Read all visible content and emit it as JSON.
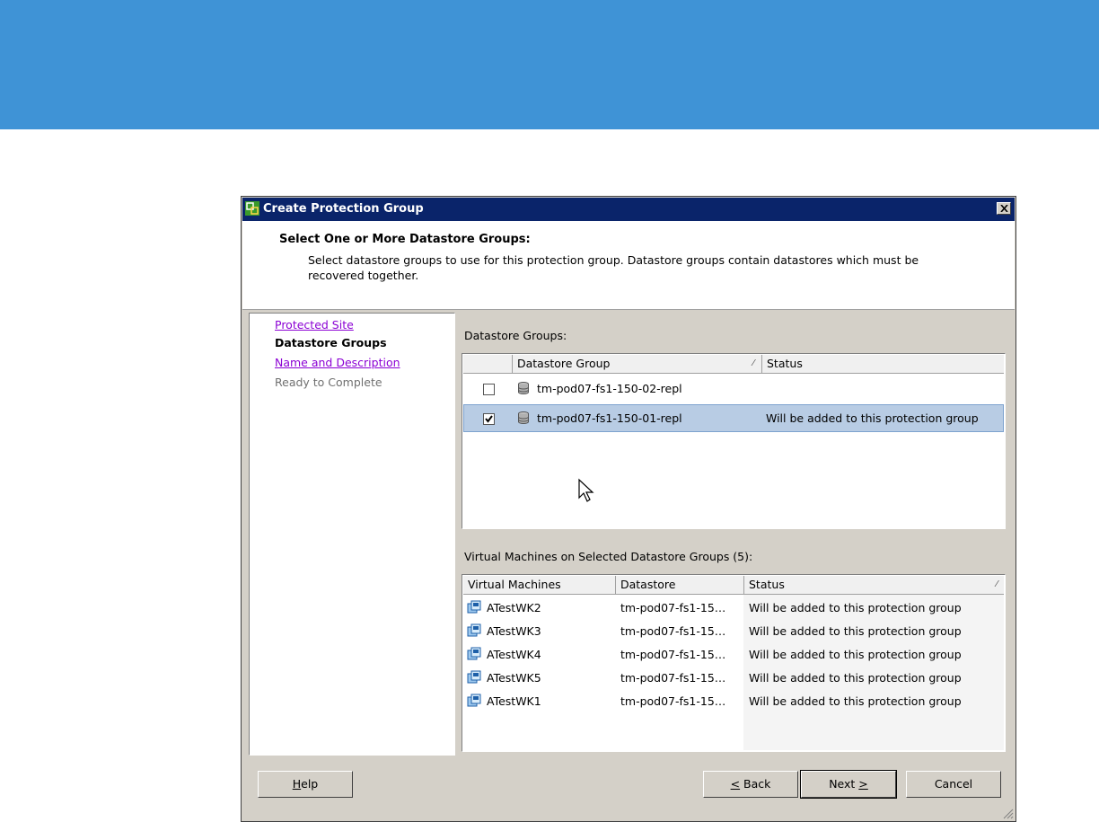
{
  "dialog": {
    "title": "Create Protection Group",
    "header_title": "Select One or More Datastore Groups:",
    "header_description": "Select datastore groups to use for this protection group. Datastore groups contain datastores which must be recovered together."
  },
  "steps": [
    {
      "label": "Protected Site",
      "state": "link"
    },
    {
      "label": "Datastore Groups",
      "state": "current"
    },
    {
      "label": "Name and Description",
      "state": "link"
    },
    {
      "label": "Ready to Complete",
      "state": "disabled"
    }
  ],
  "datastore_groups": {
    "label": "Datastore Groups:",
    "columns": [
      "Datastore Group",
      "Status"
    ],
    "rows": [
      {
        "checked": false,
        "name": "tm-pod07-fs1-150-02-repl",
        "status": ""
      },
      {
        "checked": true,
        "name": "tm-pod07-fs1-150-01-repl",
        "status": "Will be added to this protection group"
      }
    ]
  },
  "vms": {
    "label": "Virtual Machines on Selected Datastore Groups (5):",
    "columns": [
      "Virtual Machines",
      "Datastore",
      "Status"
    ],
    "rows": [
      {
        "name": "ATestWK2",
        "datastore": "tm-pod07-fs1-15…",
        "status": "Will be added to this protection group"
      },
      {
        "name": "ATestWK3",
        "datastore": "tm-pod07-fs1-15…",
        "status": "Will be added to this protection group"
      },
      {
        "name": "ATestWK4",
        "datastore": "tm-pod07-fs1-15…",
        "status": "Will be added to this protection group"
      },
      {
        "name": "ATestWK5",
        "datastore": "tm-pod07-fs1-15…",
        "status": "Will be added to this protection group"
      },
      {
        "name": "ATestWK1",
        "datastore": "tm-pod07-fs1-15…",
        "status": "Will be added to this protection group"
      }
    ]
  },
  "buttons": {
    "help": {
      "accel": "H",
      "rest": "elp"
    },
    "back": {
      "accel": "<",
      "rest": " Back"
    },
    "next": {
      "pre": "Next ",
      "accel": ">"
    },
    "cancel": "Cancel"
  },
  "colors": {
    "banner": "#3f93d6",
    "titlebar": "#0a246a",
    "selection": "#b8cce4",
    "link": "#8b00d4"
  }
}
